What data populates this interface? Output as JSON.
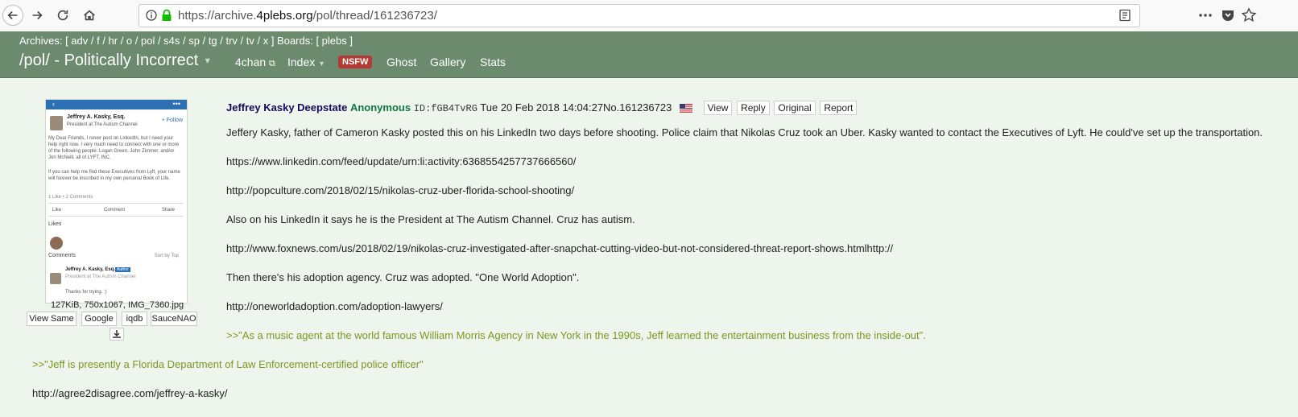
{
  "browser": {
    "url_prefix": "https://archive.",
    "url_domain": "4plebs.org",
    "url_path": "/pol/thread/161236723/"
  },
  "header": {
    "archives_line": "Archives: [ adv / f / hr / o / pol / s4s / sp / tg / trv / tv / x ] Boards: [ plebs ]",
    "board_title": "/pol/ - Politically Incorrect",
    "nav": {
      "fourchan": "4chan",
      "index": "Index",
      "nsfw": "NSFW",
      "ghost": "Ghost",
      "gallery": "Gallery",
      "stats": "Stats"
    }
  },
  "thumbnail": {
    "profile_name": "Jeffrey A. Kasky, Esq.",
    "profile_title": "President at The Autism Channel",
    "follow": "+ Follow",
    "message_1": "My Dear Friends, I never post on LinkedIn, but I need your help right now. I very much need to connect with one or more of the following people: Logan Green, John Zimmer, and/or Jon McNeill, all of LYFT, INC.",
    "message_2": "If you can help me find these Executives from Lyft, your name will forever be inscribed in my own personal Book of Life.",
    "stats": "1 Like • 2 Comments",
    "like": "Like",
    "comment": "Comment",
    "share": "Share",
    "likes_heading": "Likes",
    "comments_heading": "Comments",
    "sort": "Sort by Top",
    "comment_author": "Jeffrey A. Kasky, Esq.",
    "author_badge": "Author",
    "comment_text": "Thanks for trying. :)"
  },
  "file": {
    "info": "127KiB, 750x1067, IMG_7360.jpg",
    "buttons": {
      "view_same": "View Same",
      "google": "Google",
      "iqdb": "iqdb",
      "saucenao": "SauceNAO"
    }
  },
  "post": {
    "subject": "Jeffrey Kasky Deepstate",
    "name": "Anonymous",
    "id": "ID:fGB4TvRG",
    "time": "Tue 20 Feb 2018 14:04:27",
    "number": "No.161236723",
    "buttons": {
      "view": "View",
      "reply": "Reply",
      "original": "Original",
      "report": "Report"
    },
    "lines": [
      "Jeffery Kasky, father of Cameron Kasky posted this on his LinkedIn two days before shooting. Police claim that Nikolas Cruz took an Uber. Kasky wanted to contact the Executives of Lyft. He could've set up the transportation.",
      "https://www.linkedin.com/feed/update/urn:li:activity:6368554257737666560/",
      "http://popculture.com/2018/02/15/nikolas-cruz-uber-florida-school-shooting/",
      "Also on his LinkedIn it says he is the President at The Autism Channel. Cruz has autism.",
      "http://www.foxnews.com/us/2018/02/19/nikolas-cruz-investigated-after-snapchat-cutting-video-but-not-considered-threat-report-shows.htmlhttp://",
      "Then there's his adoption agency. Cruz was adopted. \"One World Adoption\".",
      "http://oneworldadoption.com/adoption-lawyers/",
      ">>\"As a music agent at the world famous William Morris Agency in New York in the 1990s, Jeff learned the entertainment business from the inside-out\".",
      ">>\"Jeff is presently a Florida Department of Law Enforcement-certified police officer\"",
      "http://agree2disagree.com/jeffrey-a-kasky/"
    ]
  },
  "colors": {
    "header_bg": "#6b8a6e",
    "page_bg": "#eef5ec",
    "subject": "#0f0c5d",
    "name": "#117743",
    "quote": "#789922",
    "nsfw": "#b33b33"
  }
}
